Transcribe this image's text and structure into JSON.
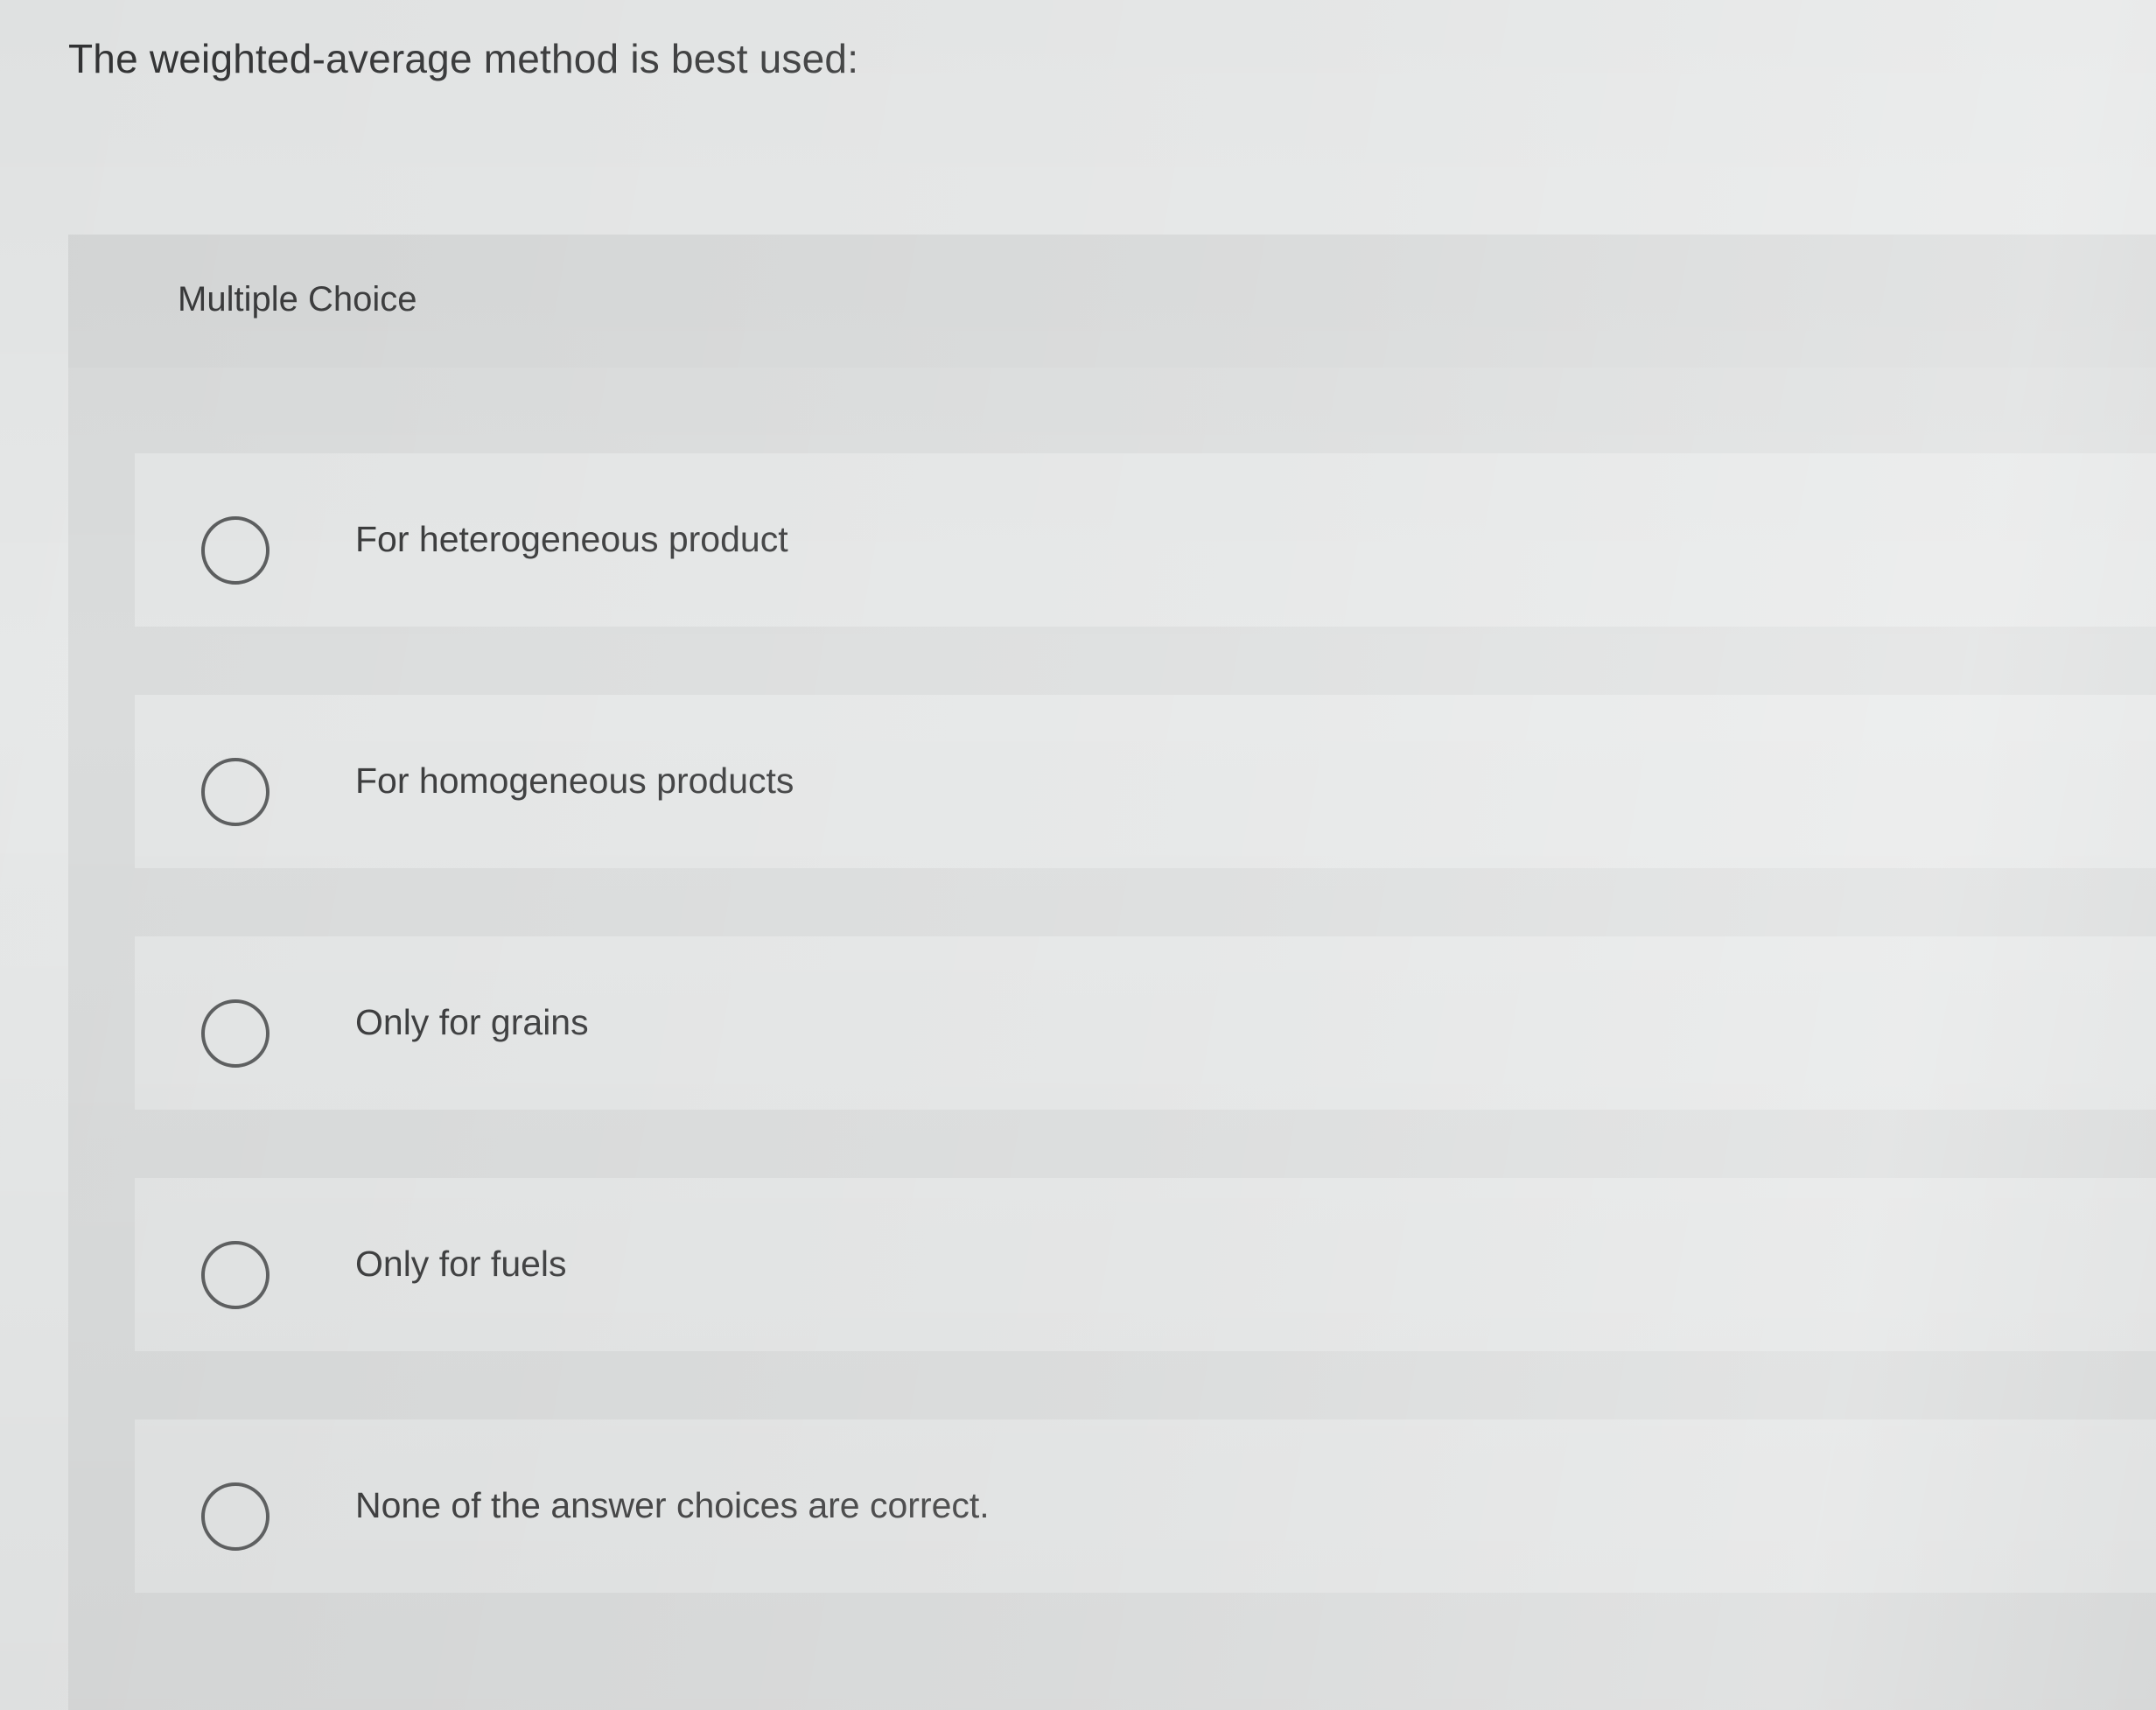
{
  "question": {
    "text": "The weighted-average method is best used:"
  },
  "panel": {
    "type_label": "Multiple Choice"
  },
  "choices": [
    {
      "label": "For heterogeneous product",
      "selected": false
    },
    {
      "label": "For homogeneous products",
      "selected": false
    },
    {
      "label": "Only for grains",
      "selected": false
    },
    {
      "label": "Only for fuels",
      "selected": false
    },
    {
      "label": "None of the answer choices are correct.",
      "selected": false
    }
  ],
  "colors": {
    "page_background": "#e6e8e8",
    "panel_background": "#d9dbdb",
    "choice_background": "#e3e5e5",
    "text": "#2e2f30",
    "radio_border": "#555758"
  },
  "icons": {
    "radio": "radio-circle-icon"
  }
}
